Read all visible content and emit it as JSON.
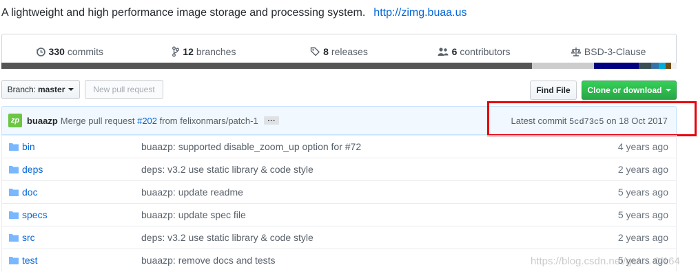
{
  "repo": {
    "description": "A lightweight and high performance image storage and processing system.",
    "homepage": "http://zimg.buaa.us"
  },
  "summary": [
    {
      "icon": "history-icon",
      "num": "330",
      "label": "commits"
    },
    {
      "icon": "git-branch-icon",
      "num": "12",
      "label": "branches"
    },
    {
      "icon": "tag-icon",
      "num": "8",
      "label": "releases"
    },
    {
      "icon": "organization-icon",
      "num": "6",
      "label": "contributors"
    },
    {
      "icon": "law-icon",
      "num": "",
      "label": "BSD-3-Clause"
    }
  ],
  "language_bar": [
    {
      "color": "#555555",
      "share": 0.786
    },
    {
      "color": "#cccccc",
      "share": 0.092
    },
    {
      "color": "#000080",
      "share": 0.066
    },
    {
      "color": "#384d54",
      "share": 0.018
    },
    {
      "color": "#3572A5",
      "share": 0.012
    },
    {
      "color": "#00ADD8",
      "share": 0.01
    },
    {
      "color": "#6e4c13",
      "share": 0.008
    },
    {
      "color": "#f0f0f0",
      "share": 0.008
    }
  ],
  "toolbar": {
    "branch_label": "Branch:",
    "branch_value": "master",
    "new_pr_label": "New pull request",
    "find_file_label": "Find File",
    "clone_label": "Clone or download"
  },
  "commit": {
    "avatar_text": "zp",
    "author": "buaazp",
    "message_prefix": "Merge pull request",
    "pr_link": "#202",
    "message_suffix": "from felixonmars/patch-1",
    "ellipsis": "…",
    "latest_label": "Latest commit",
    "sha": "5cd73c5",
    "date": "on 18 Oct 2017"
  },
  "files": [
    {
      "name": "bin",
      "message": "buaazp: supported disable_zoom_up option for #72",
      "age": "4 years ago"
    },
    {
      "name": "deps",
      "message": "deps: v3.2 use static library & code style",
      "age": "2 years ago"
    },
    {
      "name": "doc",
      "message": "buaazp: update readme",
      "age": "5 years ago"
    },
    {
      "name": "specs",
      "message": "buaazp: update spec file",
      "age": "5 years ago"
    },
    {
      "name": "src",
      "message": "deps: v3.2 use static library & code style",
      "age": "2 years ago"
    },
    {
      "name": "test",
      "message": "buaazp: remove docs and tests",
      "age": "5 years ago"
    }
  ],
  "watermark": "https://blog.csdn.net/gc/ ... 0/164",
  "colors": {
    "link": "#0366d6",
    "highlight": "#e8000b",
    "clone_button": "#28a745"
  }
}
